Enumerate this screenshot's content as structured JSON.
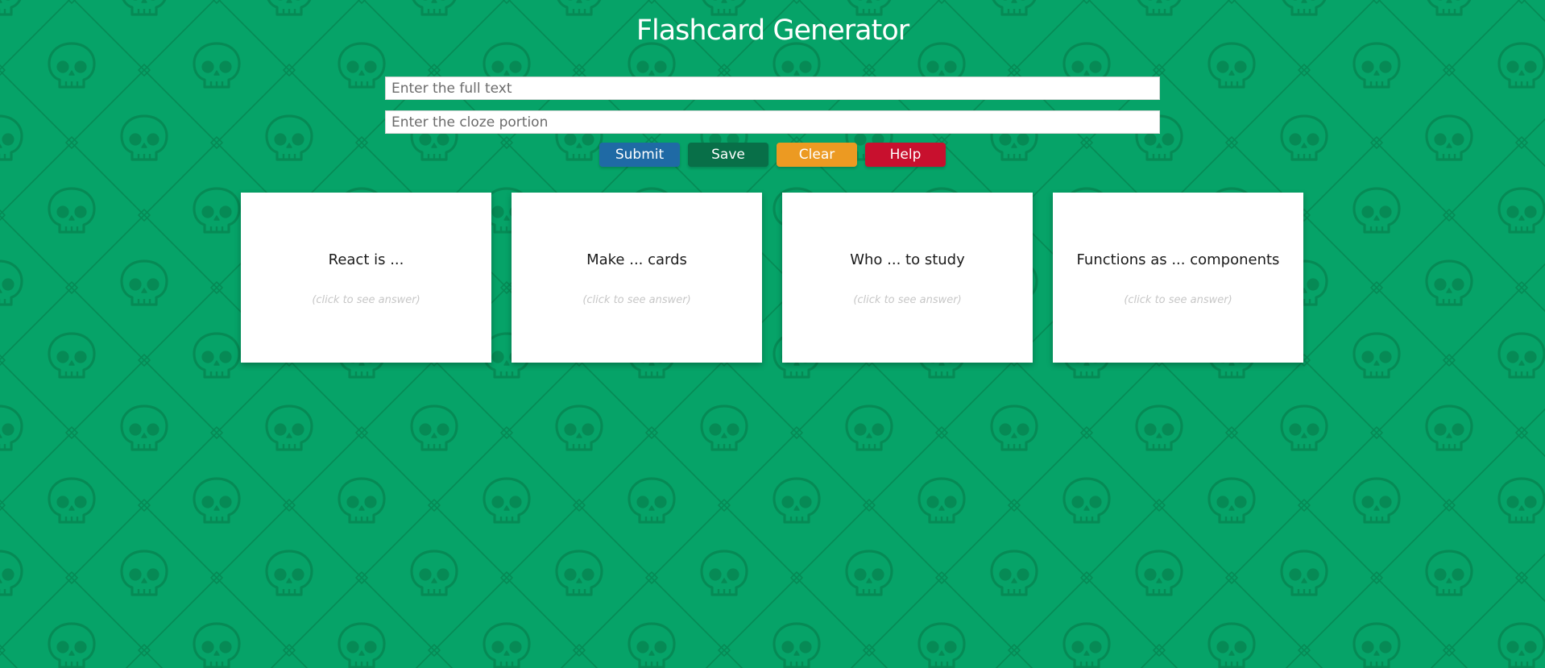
{
  "page": {
    "title": "Flashcard Generator",
    "background_color": "#06a368",
    "pattern_color": "#068a55",
    "pattern_icon": "skull-icon"
  },
  "form": {
    "full_text_placeholder": "Enter the full text",
    "cloze_placeholder": "Enter the cloze portion"
  },
  "buttons": [
    {
      "label": "Submit",
      "color": "#1f6aa5"
    },
    {
      "label": "Save",
      "color": "#086f48"
    },
    {
      "label": "Clear",
      "color": "#ec9a22"
    },
    {
      "label": "Help",
      "color": "#c8102e"
    }
  ],
  "cards": [
    {
      "question": "React is ...",
      "hint": "(click to see answer)"
    },
    {
      "question": "Make ... cards",
      "hint": "(click to see answer)"
    },
    {
      "question": "Who ... to study",
      "hint": "(click to see answer)"
    },
    {
      "question": "Functions as ... components",
      "hint": "(click to see answer)"
    }
  ]
}
